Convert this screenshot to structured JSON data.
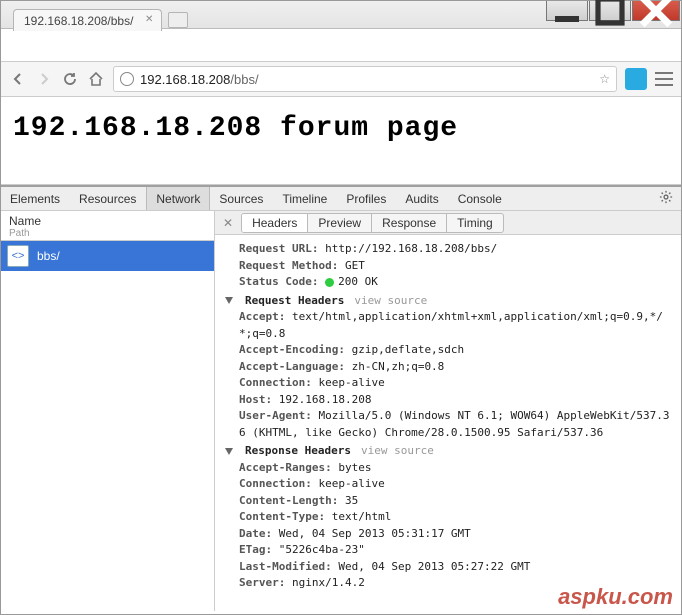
{
  "window": {
    "tab_title": "192.168.18.208/bbs/"
  },
  "toolbar": {
    "url_host": "192.168.18.208",
    "url_path": "/bbs/"
  },
  "page": {
    "heading": "192.168.18.208 forum page"
  },
  "devtools": {
    "tabs": [
      "Elements",
      "Resources",
      "Network",
      "Sources",
      "Timeline",
      "Profiles",
      "Audits",
      "Console"
    ],
    "active_tab": "Network",
    "left": {
      "header_name": "Name",
      "header_path": "Path",
      "request_name": "bbs/"
    },
    "subtabs": [
      "Headers",
      "Preview",
      "Response",
      "Timing"
    ],
    "active_subtab": "Headers",
    "general": {
      "request_url": {
        "k": "Request URL:",
        "v": "http://192.168.18.208/bbs/"
      },
      "request_method": {
        "k": "Request Method:",
        "v": "GET"
      },
      "status_code": {
        "k": "Status Code:",
        "v": "200 OK"
      }
    },
    "req_headers": {
      "title": "Request Headers",
      "view_source": "view source",
      "items": [
        {
          "k": "Accept:",
          "v": "text/html,application/xhtml+xml,application/xml;q=0.9,*/*;q=0.8"
        },
        {
          "k": "Accept-Encoding:",
          "v": "gzip,deflate,sdch"
        },
        {
          "k": "Accept-Language:",
          "v": "zh-CN,zh;q=0.8"
        },
        {
          "k": "Connection:",
          "v": "keep-alive"
        },
        {
          "k": "Host:",
          "v": "192.168.18.208"
        },
        {
          "k": "User-Agent:",
          "v": "Mozilla/5.0 (Windows NT 6.1; WOW64) AppleWebKit/537.36 (KHTML, like Gecko) Chrome/28.0.1500.95 Safari/537.36"
        }
      ]
    },
    "res_headers": {
      "title": "Response Headers",
      "view_source": "view source",
      "items": [
        {
          "k": "Accept-Ranges:",
          "v": "bytes"
        },
        {
          "k": "Connection:",
          "v": "keep-alive"
        },
        {
          "k": "Content-Length:",
          "v": "35"
        },
        {
          "k": "Content-Type:",
          "v": "text/html"
        },
        {
          "k": "Date:",
          "v": "Wed, 04 Sep 2013 05:31:17 GMT"
        },
        {
          "k": "ETag:",
          "v": "\"5226c4ba-23\""
        },
        {
          "k": "Last-Modified:",
          "v": "Wed, 04 Sep 2013 05:27:22 GMT"
        },
        {
          "k": "Server:",
          "v": "nginx/1.4.2"
        }
      ]
    }
  },
  "watermark": "aspku.com"
}
